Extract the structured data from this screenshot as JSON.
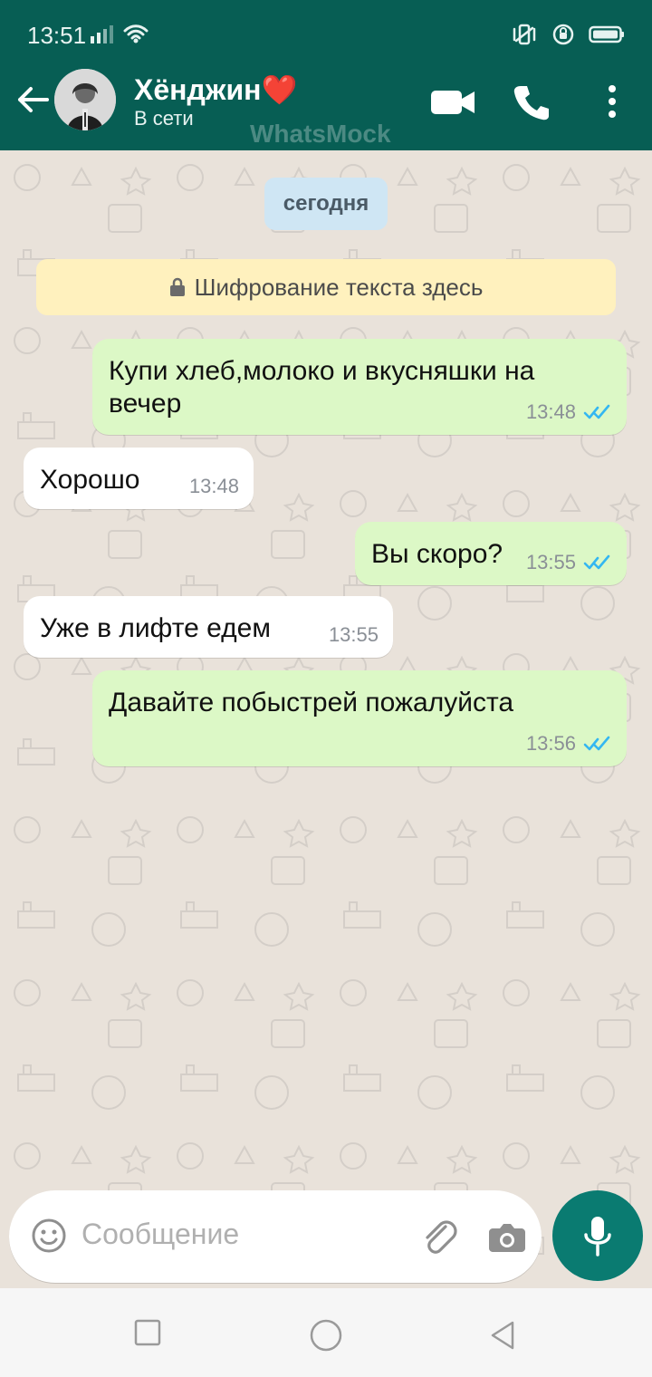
{
  "status_bar": {
    "time": "13:51"
  },
  "header": {
    "contact_name": "Хёнджин❤️",
    "presence": "В сети",
    "watermark": "WhatsMock"
  },
  "chat": {
    "date_pill": "сегодня",
    "encryption_notice": "Шифрование текста здесь",
    "messages": [
      {
        "direction": "out",
        "text": "Купи хлеб,молоко и вкусняшки на вечер",
        "time": "13:48",
        "read": true
      },
      {
        "direction": "in",
        "text": "Хорошо",
        "time": "13:48"
      },
      {
        "direction": "out",
        "text": "Вы скоро?",
        "time": "13:55",
        "read": true
      },
      {
        "direction": "in",
        "text": "Уже в лифте едем",
        "time": "13:55"
      },
      {
        "direction": "out",
        "text": "Давайте побыстрей пожалуйста",
        "time": "13:56",
        "read": true
      }
    ]
  },
  "composer": {
    "placeholder": "Сообщение"
  },
  "colors": {
    "header": "#075e54",
    "outgoing": "#dcf8c6",
    "incoming": "#ffffff",
    "read_ticks": "#34b7f1"
  },
  "icons": [
    "signal-icon",
    "wifi-icon",
    "vibrate-icon",
    "rotation-lock-icon",
    "battery-icon",
    "back-arrow-icon",
    "video-call-icon",
    "phone-call-icon",
    "more-vert-icon",
    "lock-icon",
    "emoji-icon",
    "attach-icon",
    "camera-icon",
    "mic-icon"
  ]
}
